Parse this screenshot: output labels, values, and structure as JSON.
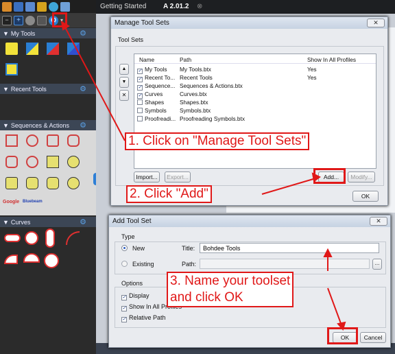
{
  "tabs": [
    {
      "label": "Getting Started"
    },
    {
      "label": "A 2.01.2"
    }
  ],
  "tool_chest": {
    "sections": [
      {
        "label": "My Tools"
      },
      {
        "label": "Recent Tools"
      },
      {
        "label": "Sequences & Actions"
      },
      {
        "label": "Curves"
      }
    ],
    "stamps": [
      "Google",
      "Bluebeam"
    ]
  },
  "manage_dialog": {
    "title": "Manage Tool Sets",
    "group_label": "Tool Sets",
    "columns": [
      "Name",
      "Path",
      "Show In All Profiles"
    ],
    "rows": [
      {
        "checked": true,
        "name": "My Tools",
        "path": "My Tools.btx",
        "show": "Yes"
      },
      {
        "checked": true,
        "name": "Recent To...",
        "path": "Recent Tools",
        "show": "Yes"
      },
      {
        "checked": true,
        "name": "Sequence...",
        "path": "Sequences & Actions.btx",
        "show": ""
      },
      {
        "checked": true,
        "name": "Curves",
        "path": "Curves.btx",
        "show": ""
      },
      {
        "checked": false,
        "name": "Shapes",
        "path": "Shapes.btx",
        "show": ""
      },
      {
        "checked": false,
        "name": "Symbols",
        "path": "Symbols.btx",
        "show": ""
      },
      {
        "checked": false,
        "name": "Proofreadi...",
        "path": "Proofreading Symbols.btx",
        "show": ""
      }
    ],
    "import_label": "Import...",
    "export_label": "Export...",
    "add_label": "Add...",
    "modify_label": "Modify...",
    "ok_label": "OK"
  },
  "add_dialog": {
    "title": "Add Tool Set",
    "type_label": "Type",
    "new_label": "New",
    "existing_label": "Existing",
    "title_field_label": "Title:",
    "title_value": "Bohdee Tools",
    "path_label": "Path:",
    "browse_label": "...",
    "options_label": "Options",
    "display_label": "Display",
    "show_all_label": "Show In All Profiles",
    "relative_label": "Relative Path",
    "ok_label": "OK",
    "cancel_label": "Cancel"
  },
  "annotations": {
    "step1": "1. Click on \"Manage Tool Sets\"",
    "step2": "2. Click \"Add\"",
    "step3_line1": "3. Name your toolset",
    "step3_line2": "and click OK"
  },
  "colors": {
    "annotation_red": "#e01818",
    "panel_header": "#3c4655"
  }
}
